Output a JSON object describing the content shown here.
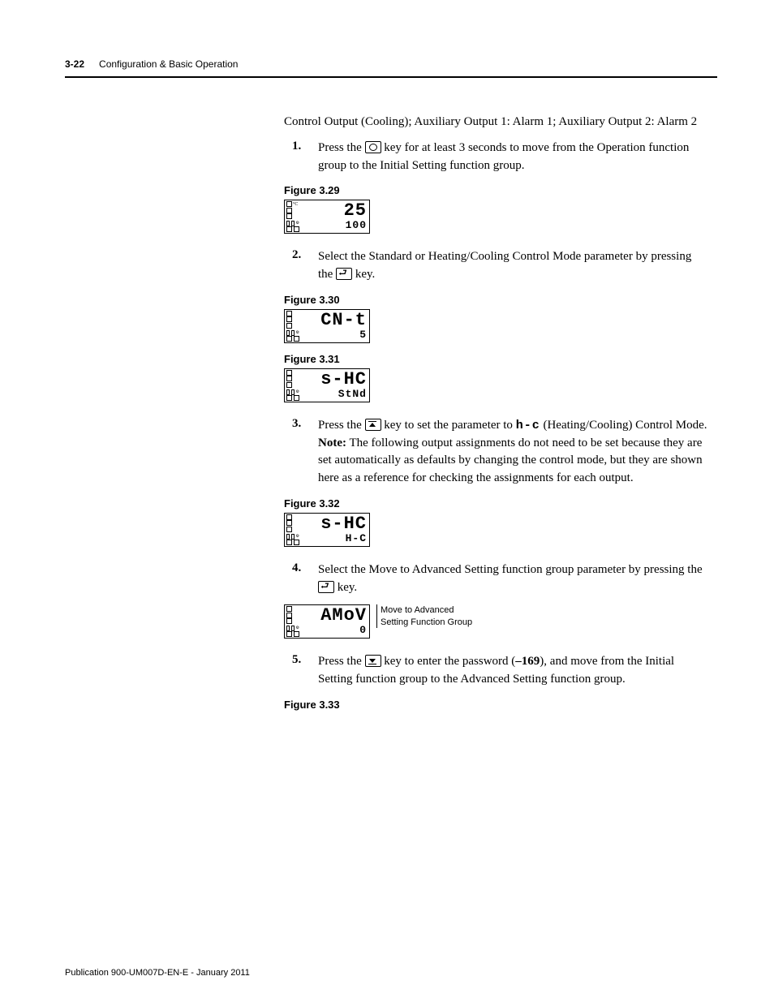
{
  "header": {
    "page_num": "3-22",
    "section": "Configuration & Basic Operation"
  },
  "intro": {
    "line": "Control Output (Cooling); Auxiliary Output 1: Alarm 1; Auxiliary Output 2: Alarm 2"
  },
  "steps": {
    "s1": {
      "num": "1.",
      "pre": "Press the ",
      "post": " key for at least 3 seconds to move from the Operation function group to the Initial Setting function group."
    },
    "s2": {
      "num": "2.",
      "pre": "Select the Standard or Heating/Cooling Control Mode parameter by pressing the ",
      "post": " key."
    },
    "s3": {
      "num": "3.",
      "pre": "Press the ",
      "mid_a": " key to set the parameter to ",
      "hc": "h-c",
      "mid_b": " (Heating/Cooling) Control Mode.",
      "note_label": "Note:",
      "note": " The following output assignments do not need to be set because they are set automatically as defaults by changing the control mode, but they are shown here as a reference for checking the assignments for each output."
    },
    "s4": {
      "num": "4.",
      "pre": "Select the Move to Advanced Setting function group parameter by pressing the ",
      "post": " key."
    },
    "s5": {
      "num": "5.",
      "pre": "Press the ",
      "mid": " key to enter the password (",
      "pwd": "–169",
      "post": "), and move from the Initial Setting function group to the Advanced Setting function group."
    }
  },
  "figures": {
    "f29": {
      "label": "Figure 3.29",
      "top": "25",
      "bottom": "100",
      "unit": "°C"
    },
    "f30": {
      "label": "Figure 3.30",
      "top": "CN-t",
      "bottom": "5"
    },
    "f31": {
      "label": "Figure 3.31",
      "top": "s-HC",
      "bottom": "StNd"
    },
    "f32": {
      "label": "Figure 3.32",
      "top": "s-HC",
      "bottom": "H-C"
    },
    "f_amov": {
      "top": "AMoV",
      "bottom": "0",
      "side1": "Move to Advanced",
      "side2": "Setting Function Group"
    },
    "f33": {
      "label": "Figure 3.33"
    }
  },
  "footer": {
    "pub": "Publication 900-UM007D-EN-E - January 2011"
  }
}
